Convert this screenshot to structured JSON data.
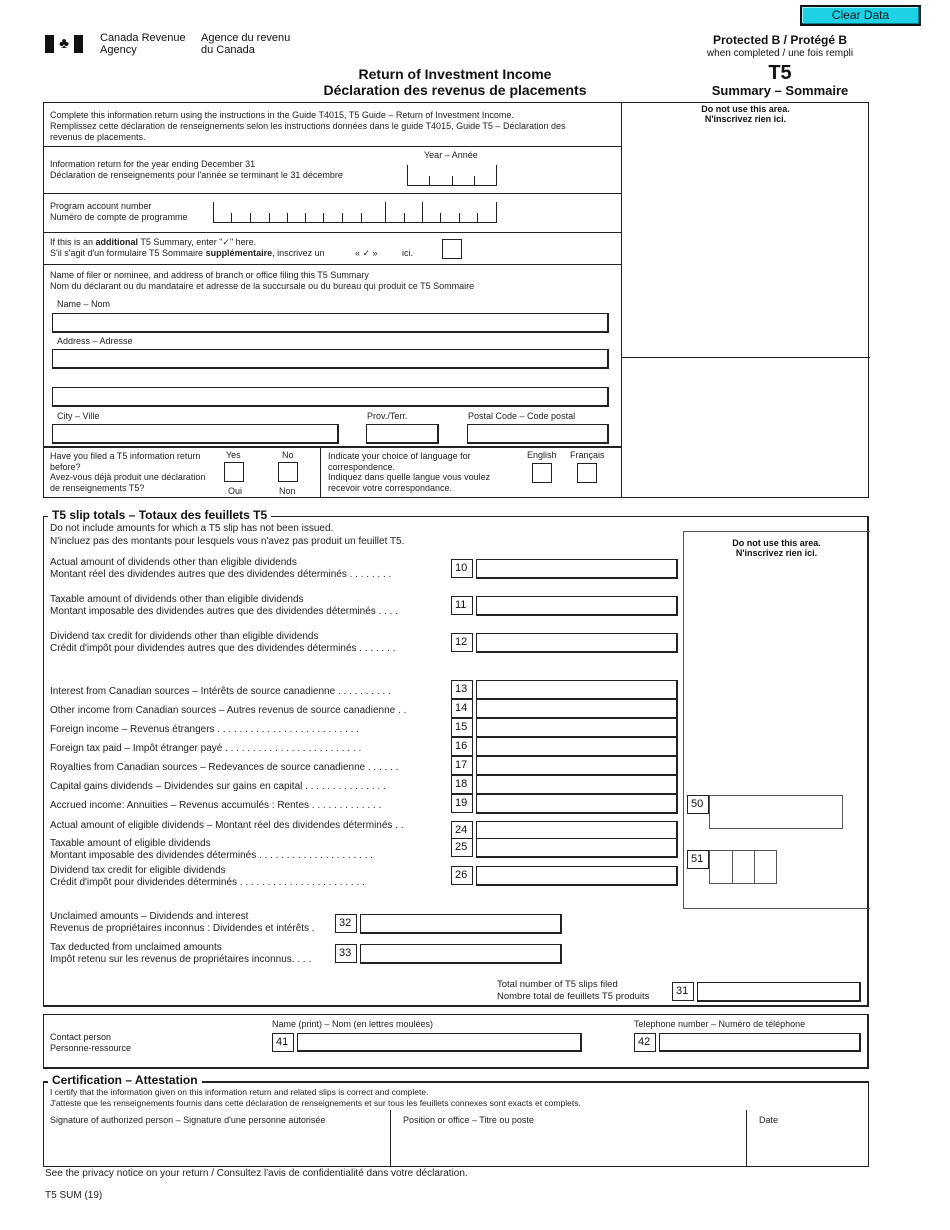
{
  "toolbar": {
    "clear_button": "Clear Data"
  },
  "header": {
    "agency_en_1": "Canada Revenue",
    "agency_en_2": "Agency",
    "agency_fr_1": "Agence du revenu",
    "agency_fr_2": "du Canada",
    "title_en": "Return of Investment Income",
    "title_fr": "Déclaration des revenus de placements",
    "protected": "Protected B / Protégé B",
    "protected_sub": "when completed / une fois rempli",
    "form_code": "T5",
    "form_subtitle": "Summary – Sommaire"
  },
  "do_not_use": {
    "line1": "Do not use this area.",
    "line2": "N'inscrivez rien ici."
  },
  "instructions": {
    "line1": "Complete this information return using the instructions in the Guide T4015, T5 Guide – Return of Investment Income.",
    "line2": "Remplissez cette déclaration de renseignements selon les instructions données dans le guide T4015, Guide T5 – Déclaration des",
    "line3": "revenus de placements."
  },
  "year": {
    "label_en": "Information return for the year ending December 31",
    "label_fr": "Déclaration de renseignements pour l'année se terminant le 31 décembre",
    "box_label": "Year – Année",
    "value": ""
  },
  "program_account": {
    "label_en": "Program account number",
    "label_fr": "Numéro de compte de programme",
    "value": ""
  },
  "additional": {
    "line1_pre": "If this is an ",
    "line1_bold": "additional",
    "line1_post": " T5 Summary, enter \"✓\" here.",
    "line2_pre": "S'il s'agit d'un formulaire T5 Sommaire ",
    "line2_bold": "supplémentaire",
    "line2_post": ", inscrivez un",
    "check_glyph": "« ✓ »",
    "ici": "ici.",
    "checked": false
  },
  "filer": {
    "heading_en": "Name of filer or nominee, and address of branch or office filing this T5 Summary",
    "heading_fr": "Nom du déclarant ou du mandataire et adresse de la succursale ou du bureau qui produit ce T5 Sommaire",
    "name_label": "Name – Nom",
    "name_value": "",
    "address_label": "Address – Adresse",
    "address1_value": "",
    "address2_value": "",
    "city_label": "City – Ville",
    "city_value": "",
    "prov_label": "Prov./Terr.",
    "prov_value": "",
    "postal_label": "Postal Code – Code postal",
    "postal_value": ""
  },
  "filed_before": {
    "line1": "Have you filed a T5 information return",
    "line2": "before?",
    "line3": "Avez-vous déjà produit une déclaration",
    "line4": "de renseignements T5?",
    "yes": "Yes",
    "no": "No",
    "oui": "Oui",
    "non": "Non"
  },
  "language": {
    "line1": "Indicate your choice of language for",
    "line2": "correspondence.",
    "line3": "Indiquez dans quelle langue vous voulez",
    "line4": "recevoir votre correspondance.",
    "english": "English",
    "francais": "Français"
  },
  "slip_totals": {
    "title": "T5 slip totals – Totaux des feuillets T5",
    "note1": "Do not include amounts for which a T5 slip has not been issued.",
    "note2": "N'incluez pas des montants pour lesquels vous n'avez pas produit un feuillet T5.",
    "rows": [
      {
        "code": "10",
        "en": "Actual amount of dividends other than eligible dividends",
        "fr": "Montant réel des dividendes autres que des dividendes déterminés  . . . . . . . .",
        "value": ""
      },
      {
        "code": "11",
        "en": "Taxable amount of dividends other than eligible dividends",
        "fr": "Montant imposable des dividendes autres que des dividendes déterminés  . . . .",
        "value": ""
      },
      {
        "code": "12",
        "en": "Dividend tax credit for dividends other than eligible dividends",
        "fr": "Crédit d'impôt pour dividendes autres que des dividendes déterminés  . . . . . . .",
        "value": ""
      },
      {
        "code": "13",
        "en": "Interest from Canadian sources – Intérêts de source canadienne  . . . . . . . . . .",
        "value": ""
      },
      {
        "code": "14",
        "en": "Other income from Canadian sources – Autres revenus de source canadienne . .",
        "value": ""
      },
      {
        "code": "15",
        "en": "Foreign income – Revenus étrangers . . . . . . . . . . . . . . . . . . . . . . . . . .",
        "value": ""
      },
      {
        "code": "16",
        "en": "Foreign tax paid – Impôt étranger payé . . . . . . . . . . . . . . . . . . . . . . . . .",
        "value": ""
      },
      {
        "code": "17",
        "en": "Royalties from Canadian sources – Redevances de source canadienne . . . . . .",
        "value": ""
      },
      {
        "code": "18",
        "en": "Capital gains dividends – Dividendes sur gains en capital . . . . . . . . . . . . . . .",
        "value": ""
      },
      {
        "code": "19",
        "en": "Accrued income: Annuities – Revenus accumulés : Rentes . . . . . . . . . . . . .",
        "value": ""
      },
      {
        "code": "24",
        "en": "Actual amount of eligible dividends – Montant réel des dividendes déterminés  . .",
        "value": ""
      },
      {
        "code": "25",
        "en": "Taxable amount of eligible dividends",
        "fr": "Montant imposable des dividendes déterminés . . . . . . . . . . . . . . . . . . . . .",
        "value": ""
      },
      {
        "code": "26",
        "en": "Dividend tax credit for eligible dividends",
        "fr": "Crédit d'impôt pour dividendes déterminés . . . . . . . . . . . . . . . . . . . . . . .",
        "value": ""
      },
      {
        "code": "32",
        "en": "Unclaimed amounts – Dividends and interest",
        "fr": "Revenus de propriétaires inconnus : Dividendes et intérêts  .",
        "value": ""
      },
      {
        "code": "33",
        "en": "Tax deducted from unclaimed amounts",
        "fr": "Impôt retenu sur les revenus de propriétaires inconnus. . . .",
        "value": ""
      }
    ],
    "office_box50": "50",
    "office_box51": "51",
    "total_slips_en": "Total number of T5 slips filed",
    "total_slips_fr": "Nombre total de feuillets T5 produits",
    "total_slips_code": "31",
    "total_slips_value": ""
  },
  "contact": {
    "label_en": "Contact person",
    "label_fr": "Personne-ressource",
    "name_label": "Name (print) – Nom (en lettres moulées)",
    "name_code": "41",
    "name_value": "",
    "phone_label": "Telephone number – Numéro de téléphone",
    "phone_code": "42",
    "phone_value": ""
  },
  "certification": {
    "title": "Certification – Attestation",
    "line1": "I certify that the information given on this information return and related slips is correct and complete.",
    "line2": "J'atteste que les renseignements fournis dans cette déclaration de renseignements et sur tous les feuillets connexes sont exacts et complets.",
    "signature_label": "Signature of authorized person – Signature d'une personne autorisée",
    "position_label": "Position or office – Titre ou poste",
    "date_label": "Date"
  },
  "footer": {
    "privacy": "See the privacy notice on your return / Consultez l'avis de confidentialité dans votre déclaration.",
    "form_id": "T5 SUM (19)"
  }
}
